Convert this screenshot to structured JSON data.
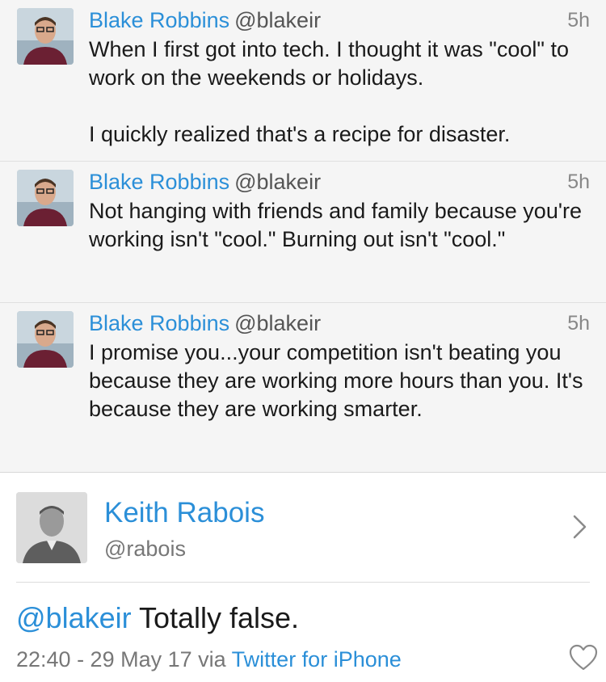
{
  "thread": [
    {
      "name": "Blake Robbins",
      "handle": "@blakeir",
      "time": "5h",
      "text": "When I first got into tech. I thought it was \"cool\" to work on the weekends or holidays.\n\nI quickly realized that's a recipe for disaster."
    },
    {
      "name": "Blake Robbins",
      "handle": "@blakeir",
      "time": "5h",
      "text": "Not hanging with friends and family because you're working isn't \"cool.\" Burning out isn't \"cool.\""
    },
    {
      "name": "Blake Robbins",
      "handle": "@blakeir",
      "time": "5h",
      "text": "I promise you...your competition isn't beating you because they are working more hours than you. It's because they are working smarter."
    }
  ],
  "main_tweet": {
    "name": "Keith Rabois",
    "handle": "@rabois",
    "mention": "@blakeir",
    "body": " Totally false.",
    "timestamp": "22:40 - 29 May 17 via ",
    "source": "Twitter for iPhone"
  },
  "icons": {
    "chevron": "chevron-right-icon",
    "like": "heart-icon"
  },
  "colors": {
    "link_blue": "#2b8fd8",
    "thread_bg": "#f5f5f5"
  }
}
